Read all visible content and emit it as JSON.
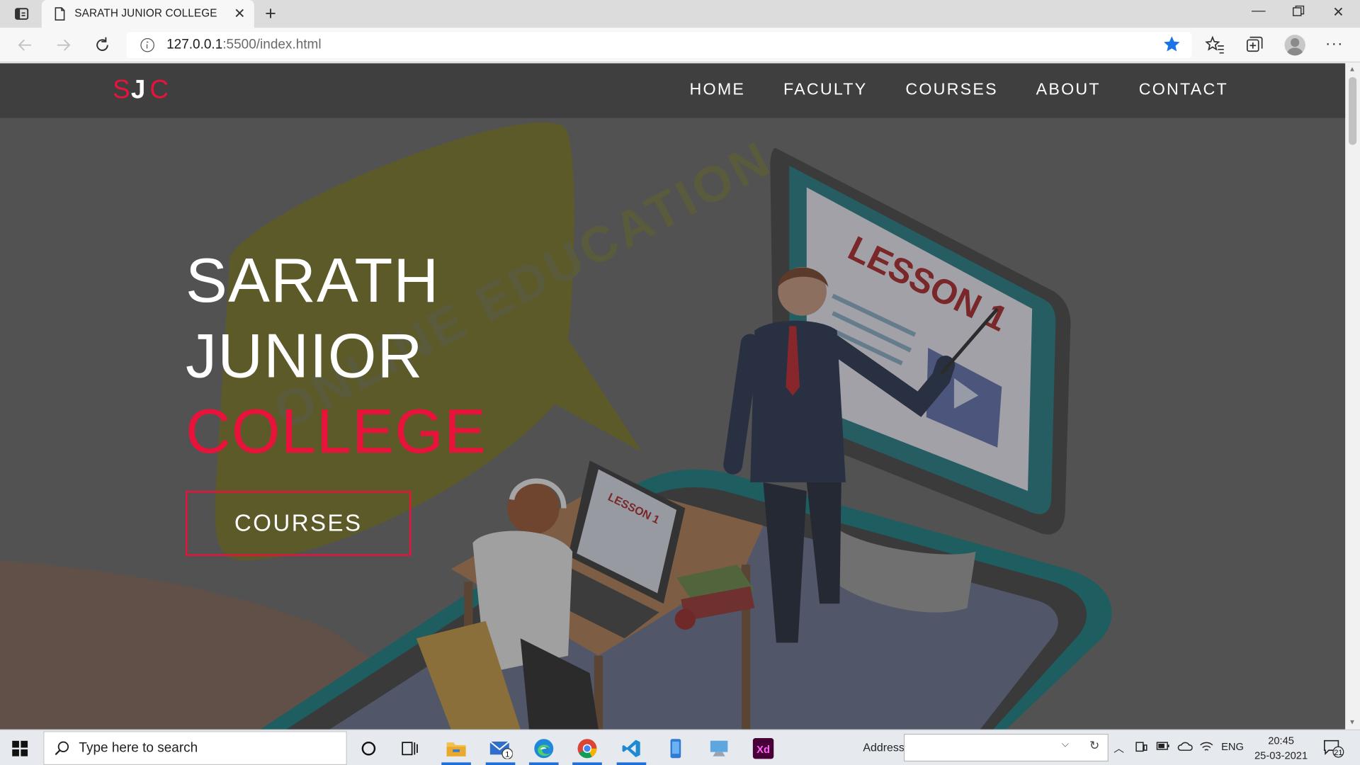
{
  "browser": {
    "tab_title": "SARATH JUNIOR COLLEGE",
    "url_host": "127.0.0.1",
    "url_path": ":5500/index.html"
  },
  "site": {
    "logo": {
      "s": "S",
      "j": "J",
      "c": "C"
    },
    "nav": [
      "HOME",
      "FACULTY",
      "COURSES",
      "ABOUT",
      "CONTACT"
    ],
    "hero": {
      "line1": "SARATH",
      "line2": "JUNIOR",
      "line3": "COLLEGE",
      "button": "COURSES"
    },
    "illustration_text": {
      "speech_bubble": "ONLINE EDUCATION",
      "screen": "LESSON 1",
      "laptop": "LESSON 1"
    },
    "accent_color": "#e8123b"
  },
  "taskbar": {
    "search_placeholder": "Type here to search",
    "address_label": "Address",
    "language": "ENG",
    "time": "20:45",
    "date": "25-03-2021",
    "mail_badge": "1",
    "notification_count": "21",
    "apps": [
      "task-view-icon",
      "file-explorer-icon",
      "mail-icon",
      "edge-icon",
      "chrome-icon",
      "vscode-icon",
      "phone-icon",
      "remote-desktop-icon",
      "adobe-xd-icon"
    ]
  }
}
